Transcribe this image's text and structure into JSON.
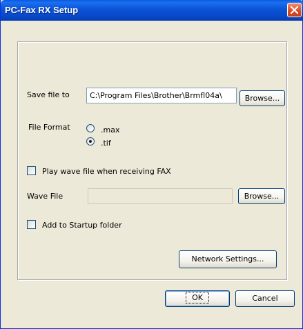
{
  "window": {
    "title": "PC-Fax RX Setup"
  },
  "save_file": {
    "label": "Save file to",
    "path_value": "C:\\Program Files\\Brother\\Brmfl04a\\",
    "browse_label": "Browse..."
  },
  "file_format": {
    "label": "File Format",
    "options": [
      {
        "label": ".max",
        "selected": false
      },
      {
        "label": ".tif",
        "selected": true
      }
    ]
  },
  "wave": {
    "play_checkbox_label": "Play wave file when receiving FAX",
    "play_checked": false,
    "file_label": "Wave File",
    "file_value": "",
    "browse_label": "Browse..."
  },
  "startup": {
    "label": "Add to Startup folder",
    "checked": false
  },
  "buttons": {
    "network_settings": "Network Settings...",
    "ok": "OK",
    "cancel": "Cancel"
  }
}
